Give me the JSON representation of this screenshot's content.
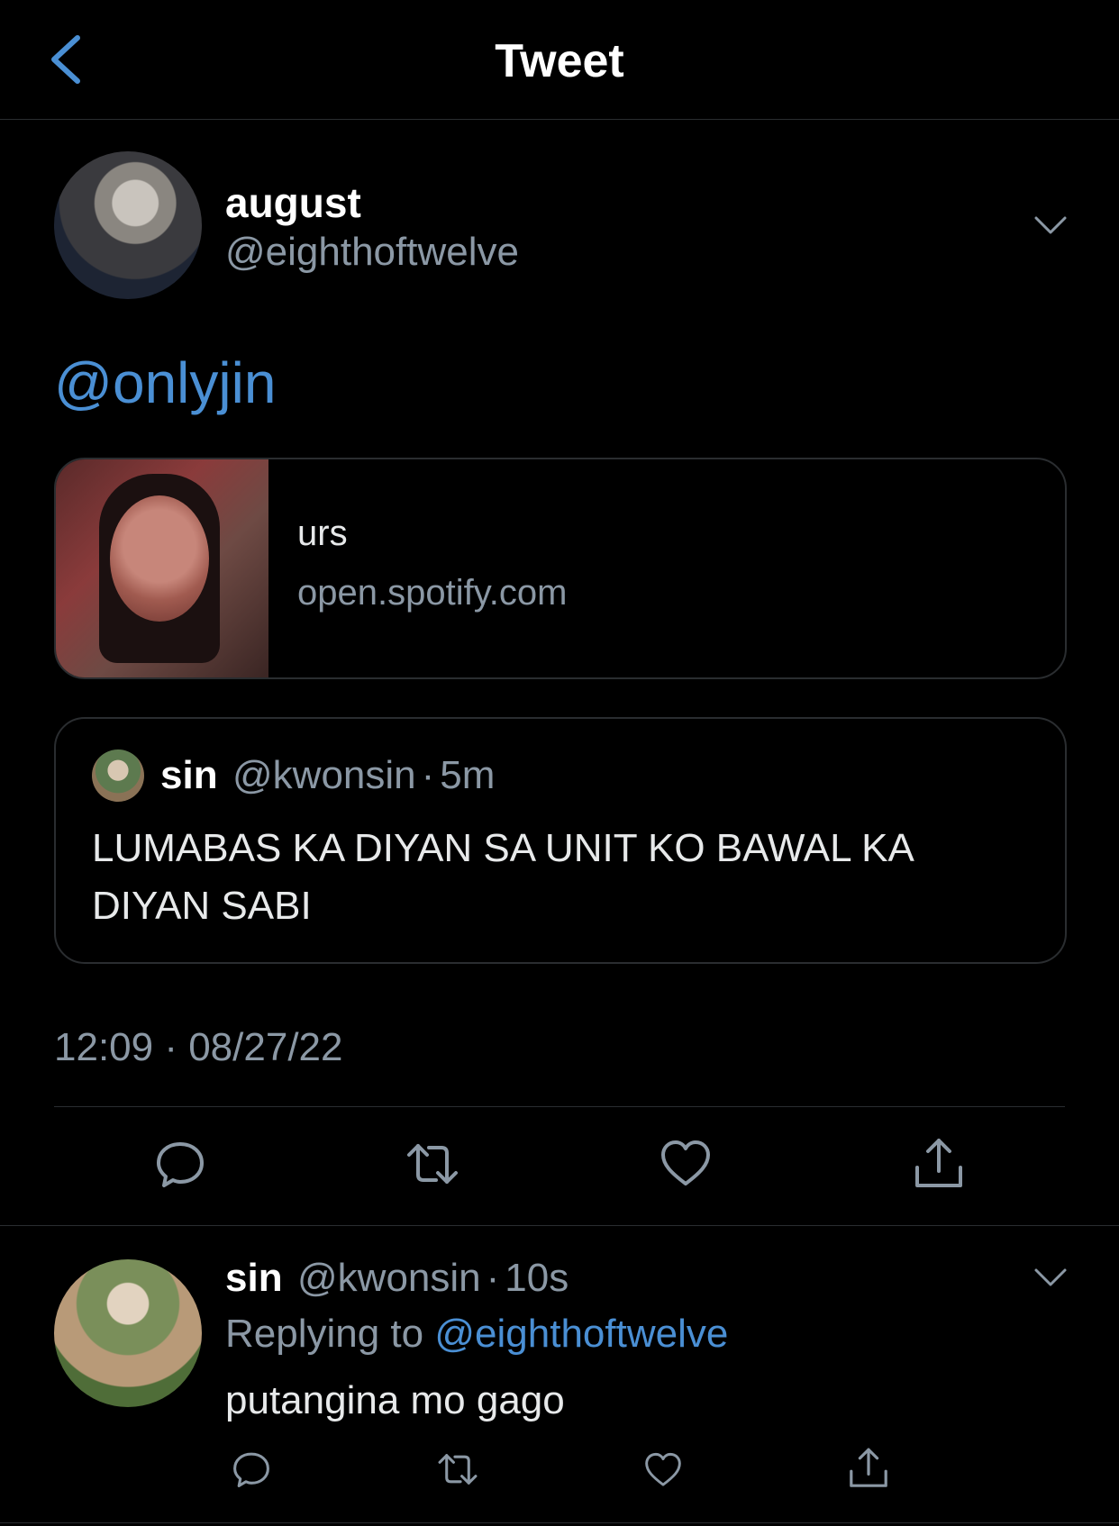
{
  "header": {
    "title": "Tweet",
    "back_icon": "chevron-left-icon"
  },
  "tweet": {
    "author": {
      "name": "august",
      "handle": "@eighthoftwelve"
    },
    "text": "@onlyjin",
    "link_card": {
      "title": "urs",
      "domain": "open.spotify.com"
    },
    "quote": {
      "name": "sin",
      "handle": "@kwonsin",
      "separator": "·",
      "time": "5m",
      "text": "LUMABAS KA DIYAN SA UNIT KO BAWAL KA DIYAN SABI"
    },
    "timestamp": "12:09 · 08/27/22",
    "actions": [
      "reply-icon",
      "retweet-icon",
      "like-icon",
      "share-icon"
    ]
  },
  "reply": {
    "name": "sin",
    "handle": "@kwonsin",
    "separator": "·",
    "time": "10s",
    "replying_to_label": "Replying to",
    "replying_to_handle": "@eighthoftwelve",
    "text": "putangina mo gago"
  },
  "colors": {
    "background": "#000000",
    "accent": "#4a8fd4",
    "secondary_text": "#8b98a5",
    "border": "#2a2d30"
  }
}
